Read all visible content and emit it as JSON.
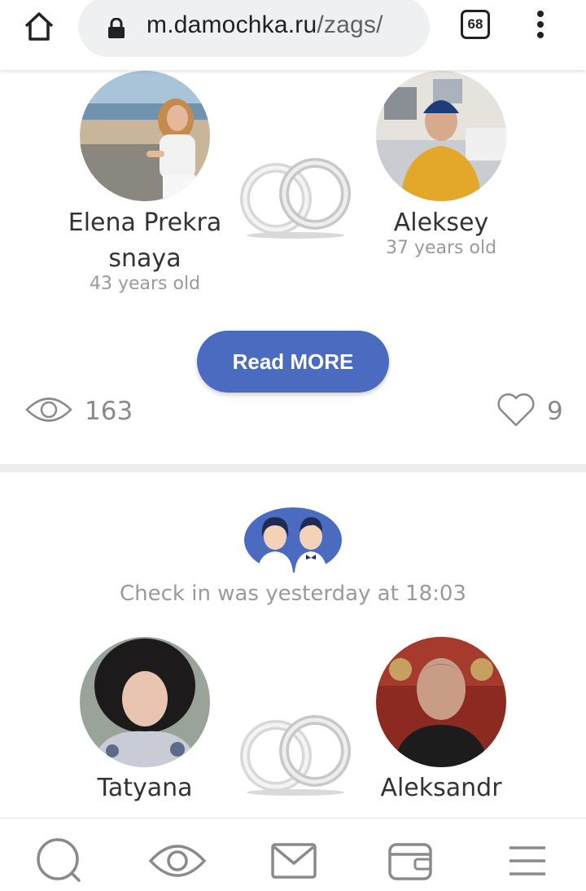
{
  "browser": {
    "url_domain": "m.damochka.ru",
    "url_path": "/zags/",
    "tab_count": "68",
    "icons": [
      "home-icon",
      "lock-icon",
      "tabs-icon",
      "more-vert-icon"
    ]
  },
  "feed": {
    "cards": [
      {
        "partner1": {
          "name": "Elena Prekra snaya",
          "age": "43 years old"
        },
        "partner2": {
          "name": "Aleksey",
          "age": "37 years old"
        },
        "read_more_label": "Read MORE",
        "views": "163",
        "likes": "9"
      },
      {
        "checkin_text": "Check in was yesterday at 18:03",
        "partner1": {
          "name": "Tatyana"
        },
        "partner2": {
          "name": "Aleksandr"
        }
      }
    ]
  },
  "bottom_nav": {
    "items": [
      "search-icon",
      "eye-icon",
      "mail-icon",
      "wallet-icon",
      "menu-icon"
    ]
  },
  "colors": {
    "accent": "#4a6bbf",
    "muted_text": "#9a9a9a",
    "icon_gray": "#8a8a8a"
  }
}
